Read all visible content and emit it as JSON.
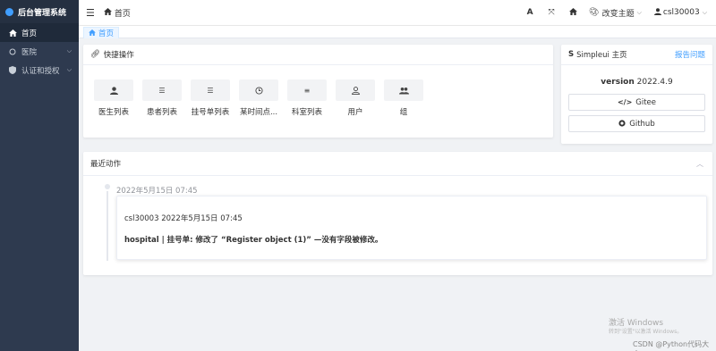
{
  "sidebar": {
    "brand": "后台管理系统",
    "items": [
      {
        "label": "首页",
        "icon": "home-icon",
        "active": true
      },
      {
        "label": "医院",
        "icon": "circle-icon",
        "has_children": true
      },
      {
        "label": "认证和授权",
        "icon": "shield-icon",
        "has_children": true
      }
    ]
  },
  "topbar": {
    "breadcrumb": "首页",
    "theme_label": "改变主题",
    "user_label": "csl30003"
  },
  "tabs": [
    {
      "label": "首页"
    }
  ],
  "quick_actions": {
    "title": "快捷操作",
    "items": [
      {
        "label": "医生列表",
        "icon": "user-icon"
      },
      {
        "label": "患者列表",
        "icon": "list-icon"
      },
      {
        "label": "挂号单列表",
        "icon": "list-icon"
      },
      {
        "label": "某时间点...",
        "icon": "clock-icon"
      },
      {
        "label": "科室列表",
        "icon": "menu-icon"
      },
      {
        "label": "用户",
        "icon": "user-outline-icon"
      },
      {
        "label": "组",
        "icon": "users-icon"
      }
    ]
  },
  "simpleui": {
    "title": "Simpleui 主页",
    "report_link": "报告问题",
    "version_label": "version",
    "version_value": "2022.4.9",
    "gitee_label": "Gitee",
    "github_label": "Github"
  },
  "recent": {
    "title": "最近动作",
    "entries": [
      {
        "time": "2022年5月15日 07:45",
        "meta": "csl30003 2022年5月15日 07:45",
        "message": "hospital | 挂号单: 修改了 “Register object (1)” —没有字段被修改。"
      }
    ]
  },
  "watermark": {
    "line1": "激活 Windows",
    "line2": "转到\"设置\"以激活 Windows。",
    "line3": "CSDN @Python代码大全"
  },
  "colors": {
    "sidebar_bg": "#2e3a4f",
    "accent": "#409eff"
  }
}
